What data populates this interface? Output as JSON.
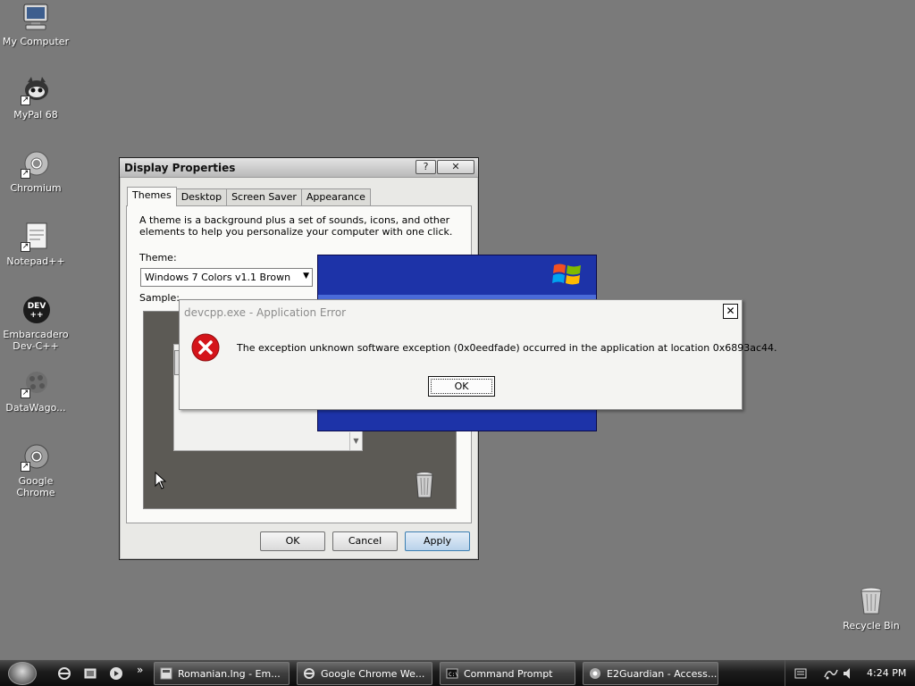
{
  "desktop": {
    "icons": [
      {
        "label": "My Computer"
      },
      {
        "label": "MyPal 68"
      },
      {
        "label": "Chromium"
      },
      {
        "label": "Notepad++"
      },
      {
        "label": "Embarcadero Dev-C++"
      },
      {
        "label": "DataWago..."
      },
      {
        "label": "Google Chrome"
      },
      {
        "label": "Recycle Bin"
      }
    ]
  },
  "display_properties": {
    "title": "Display Properties",
    "help_button": "?",
    "close_button": "✕",
    "tabs": [
      "Themes",
      "Desktop",
      "Screen Saver",
      "Appearance"
    ],
    "active_tab": "Themes",
    "description": "A theme is a background plus a set of sounds, icons, and other elements to help you personalize your computer with one click.",
    "theme_label": "Theme:",
    "theme_value": "Windows 7 Colors v1.1 Brown",
    "sample_label": "Sample:",
    "buttons": {
      "ok": "OK",
      "cancel": "Cancel",
      "apply": "Apply"
    }
  },
  "error_dialog": {
    "title": "devcpp.exe - Application Error",
    "close_button": "✕",
    "message": "The exception unknown software exception (0x0eedfade) occurred in the application at location 0x6893ac44.",
    "ok_label": "OK"
  },
  "taskbar": {
    "buttons": [
      {
        "label": "Romanian.lng - Em..."
      },
      {
        "label": "Google Chrome We..."
      },
      {
        "label": "Command Prompt"
      },
      {
        "label": "E2Guardian - Access..."
      }
    ],
    "more_glyph": "»",
    "clock": "4:24 PM"
  },
  "colors": {
    "desktop_bg": "#7a7a7a",
    "error_icon": "#d4141a",
    "xp_splash": "#1d33a8"
  }
}
